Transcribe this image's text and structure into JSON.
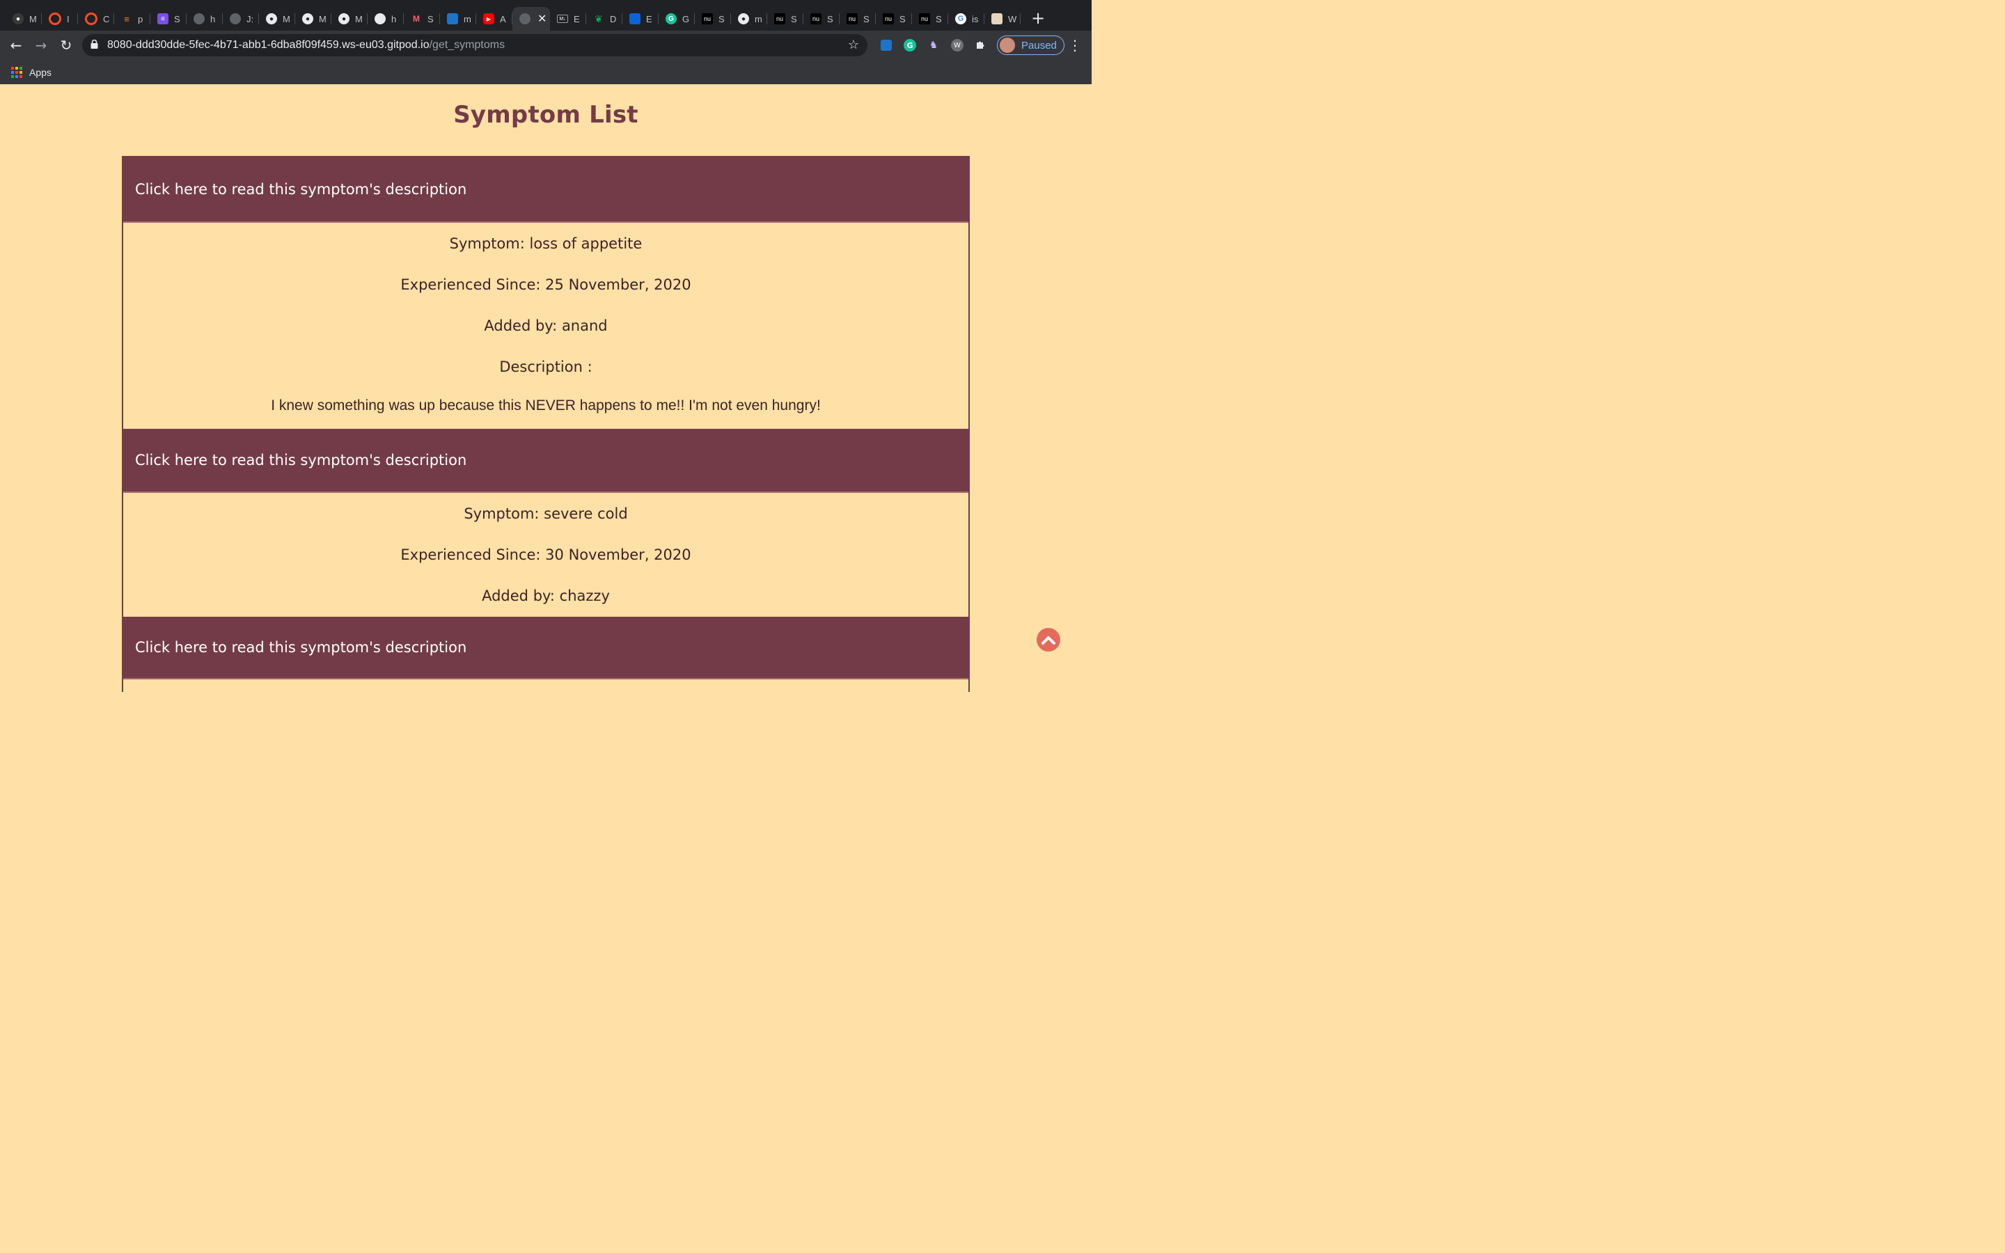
{
  "browser": {
    "tabs": [
      {
        "letter": "M",
        "icon": "github-icon"
      },
      {
        "letter": "I",
        "icon": "opera-icon"
      },
      {
        "letter": "C",
        "icon": "opera-icon"
      },
      {
        "letter": "p",
        "icon": "stackoverflow-icon"
      },
      {
        "letter": "S",
        "icon": "list-icon"
      },
      {
        "letter": "h",
        "icon": "globe-icon"
      },
      {
        "letter": "J:",
        "icon": "globe-icon"
      },
      {
        "letter": "M",
        "icon": "github-icon"
      },
      {
        "letter": "M",
        "icon": "github-icon"
      },
      {
        "letter": "M",
        "icon": "github-icon"
      },
      {
        "letter": "h",
        "icon": "globe-icon"
      },
      {
        "letter": "S",
        "icon": "m-logo-icon"
      },
      {
        "letter": "m",
        "icon": "cube-icon"
      },
      {
        "letter": "A",
        "icon": "youtube-icon"
      },
      {
        "letter": "E",
        "icon": "md-icon"
      },
      {
        "letter": "D",
        "icon": "leaf-icon"
      },
      {
        "letter": "E",
        "icon": "outlook-icon"
      },
      {
        "letter": "G",
        "icon": "grammarly-icon"
      },
      {
        "letter": "S",
        "icon": "nu-icon"
      },
      {
        "letter": "m",
        "icon": "github-icon"
      },
      {
        "letter": "S",
        "icon": "nu-icon"
      },
      {
        "letter": "S",
        "icon": "nu-icon"
      },
      {
        "letter": "S",
        "icon": "nu-icon"
      },
      {
        "letter": "S",
        "icon": "nu-icon"
      },
      {
        "letter": "S",
        "icon": "nu-icon"
      },
      {
        "letter": "is",
        "icon": "google-icon"
      },
      {
        "letter": "W",
        "icon": "store-icon"
      }
    ],
    "address": {
      "host": "8080-ddd30dde-5fec-4b71-abb1-6dba8f09f459.ws-eu03.gitpod.io",
      "path": "/get_symptoms"
    },
    "profile_label": "Paused",
    "bookmarks": {
      "apps_label": "Apps"
    }
  },
  "page": {
    "title": "Symptom List",
    "header_label": "Click here to read this symptom's description",
    "symptoms": [
      {
        "symptom": "Symptom: loss of appetite",
        "since": "Experienced Since: 25 November, 2020",
        "added_by": "Added by: anand",
        "description_label": "Description :",
        "description": "I knew something was up because this NEVER happens to me!! I'm not even hungry!"
      },
      {
        "symptom": "Symptom: severe cold",
        "since": "Experienced Since: 30 November, 2020",
        "added_by": "Added by: chazzy"
      }
    ]
  },
  "colors": {
    "page_bg": "#ffe0a6",
    "accent": "#733b48",
    "scroll_button": "#e46a5d"
  }
}
